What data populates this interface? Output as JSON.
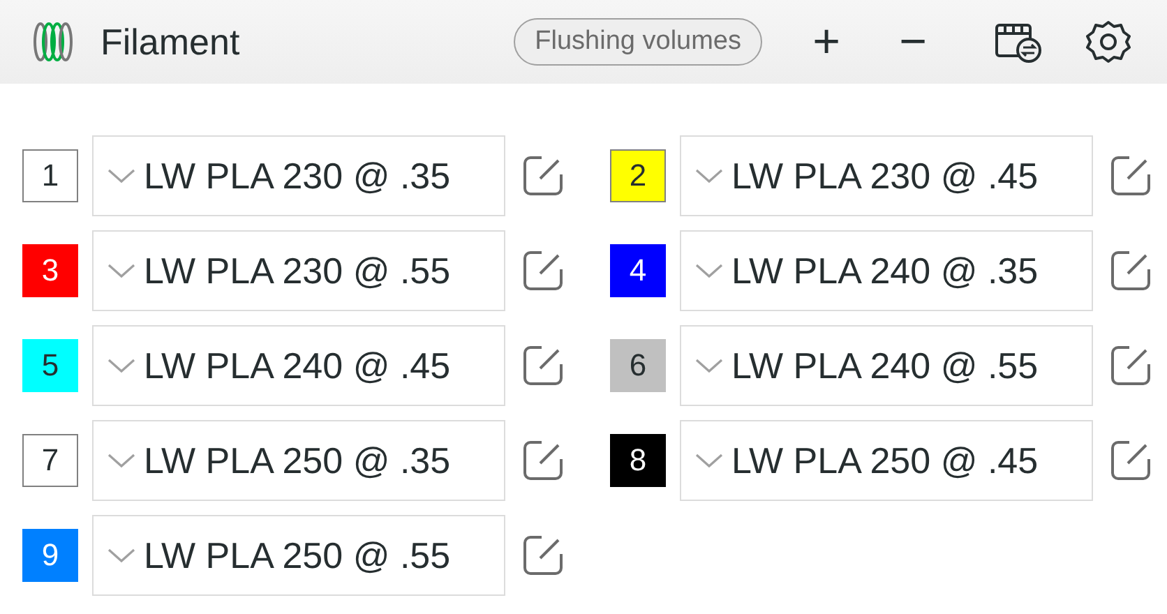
{
  "header": {
    "title": "Filament",
    "flushing_button": "Flushing volumes",
    "add_button": "+",
    "remove_button": "−"
  },
  "filaments": [
    {
      "number": "1",
      "color": "#ffffff",
      "preset": "LW PLA 230 @ .35"
    },
    {
      "number": "2",
      "color": "#ffff00",
      "preset": "LW PLA 230 @ .45"
    },
    {
      "number": "3",
      "color": "#ff0000",
      "preset": "LW PLA 230 @ .55"
    },
    {
      "number": "4",
      "color": "#0000ff",
      "preset": "LW PLA 240 @ .35"
    },
    {
      "number": "5",
      "color": "#00ffff",
      "preset": "LW PLA 240 @ .45"
    },
    {
      "number": "6",
      "color": "#c0c0c0",
      "preset": "LW PLA 240 @ .55"
    },
    {
      "number": "7",
      "color": "#ffffff",
      "preset": "LW PLA 250 @ .35"
    },
    {
      "number": "8",
      "color": "#000000",
      "preset": "LW PLA 250 @ .45"
    },
    {
      "number": "9",
      "color": "#0080ff",
      "preset": "LW PLA 250 @ .55"
    }
  ]
}
